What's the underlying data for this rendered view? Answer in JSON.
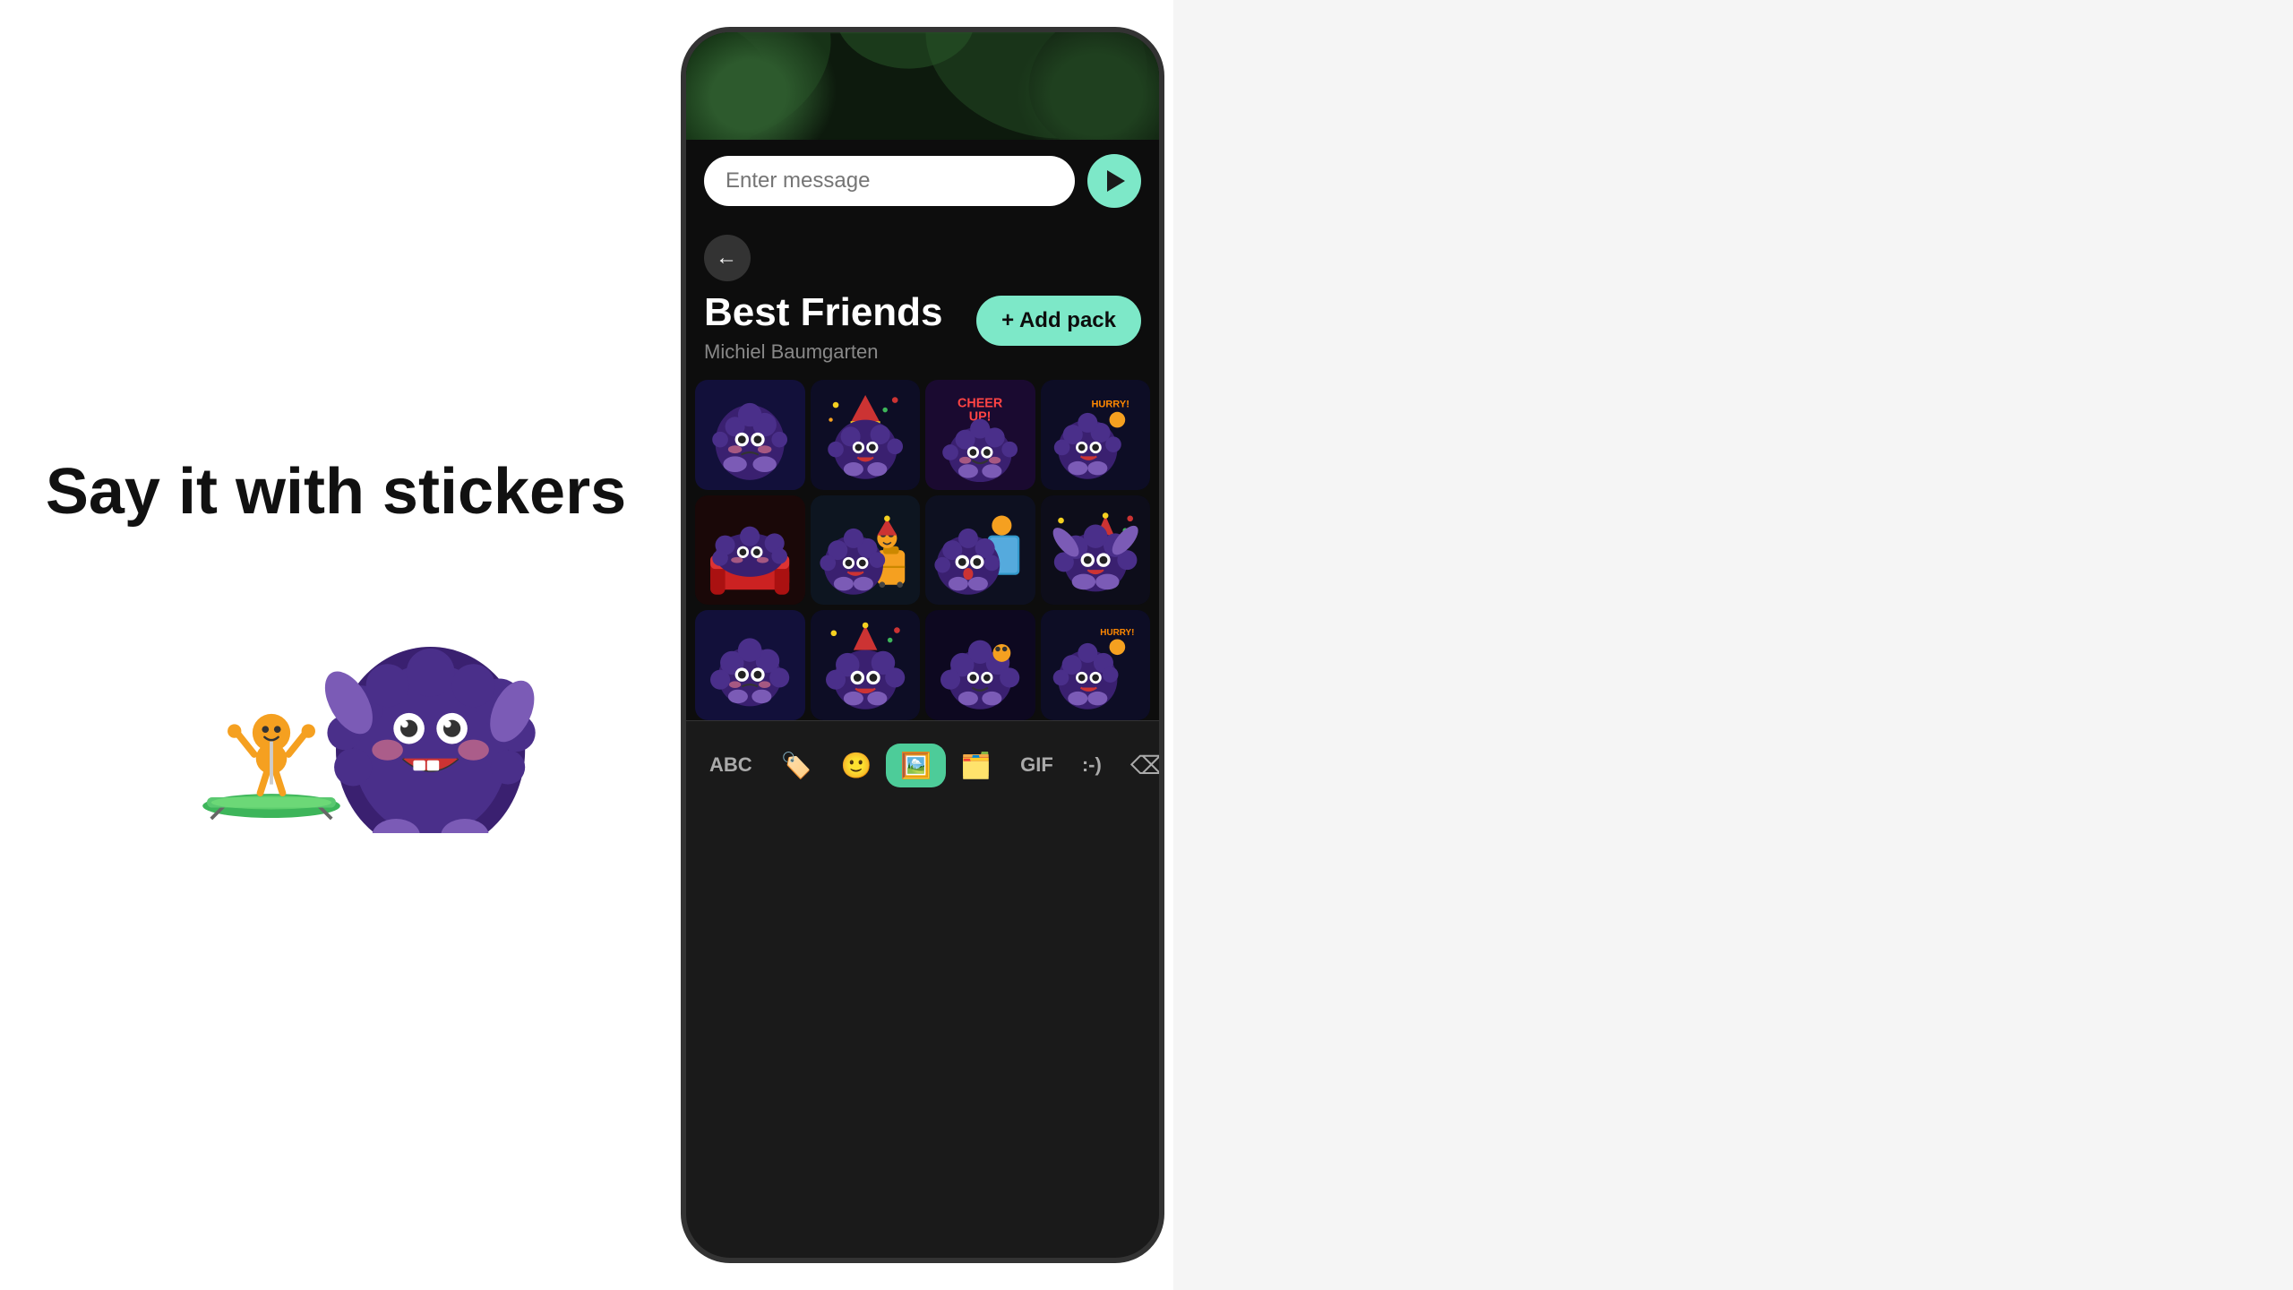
{
  "left": {
    "headline": "Say it with stickers"
  },
  "phone": {
    "message_placeholder": "Enter message",
    "pack_title": "Best Friends",
    "pack_author": "Michiel Baumgarten",
    "add_pack_label": "+ Add pack",
    "stickers": [
      {
        "id": 1,
        "type": "blob-sad",
        "row": 1,
        "col": 1
      },
      {
        "id": 2,
        "type": "blob-party",
        "row": 1,
        "col": 2
      },
      {
        "id": 3,
        "type": "blob-cheer-up",
        "row": 1,
        "col": 3
      },
      {
        "id": 4,
        "type": "blob-hurry",
        "row": 1,
        "col": 4
      },
      {
        "id": 5,
        "type": "blob-lazy",
        "row": 2,
        "col": 1
      },
      {
        "id": 6,
        "type": "blob-travel",
        "row": 2,
        "col": 2
      },
      {
        "id": 7,
        "type": "blob-surprise",
        "row": 2,
        "col": 3
      },
      {
        "id": 8,
        "type": "blob-dance",
        "row": 2,
        "col": 4
      },
      {
        "id": 9,
        "type": "blob-sad2",
        "row": 3,
        "col": 1
      },
      {
        "id": 10,
        "type": "blob-party2",
        "row": 3,
        "col": 2
      },
      {
        "id": 11,
        "type": "blob-confused",
        "row": 3,
        "col": 3
      },
      {
        "id": 12,
        "type": "blob-hurry2",
        "row": 3,
        "col": 4
      }
    ],
    "toolbar": [
      {
        "id": "abc",
        "label": "ABC",
        "icon": "",
        "active": false
      },
      {
        "id": "sticker-pack",
        "label": "",
        "icon": "🏷",
        "active": false
      },
      {
        "id": "emoji",
        "label": "",
        "icon": "🙂",
        "active": false
      },
      {
        "id": "sticker",
        "label": "",
        "icon": "🖼",
        "active": true
      },
      {
        "id": "gif-alt",
        "label": "",
        "icon": "🗂",
        "active": false
      },
      {
        "id": "gif",
        "label": "GIF",
        "icon": "",
        "active": false
      },
      {
        "id": "smileys",
        "label": ":-)",
        "icon": "",
        "active": false
      },
      {
        "id": "delete",
        "label": "",
        "icon": "⌫",
        "active": false
      }
    ]
  }
}
